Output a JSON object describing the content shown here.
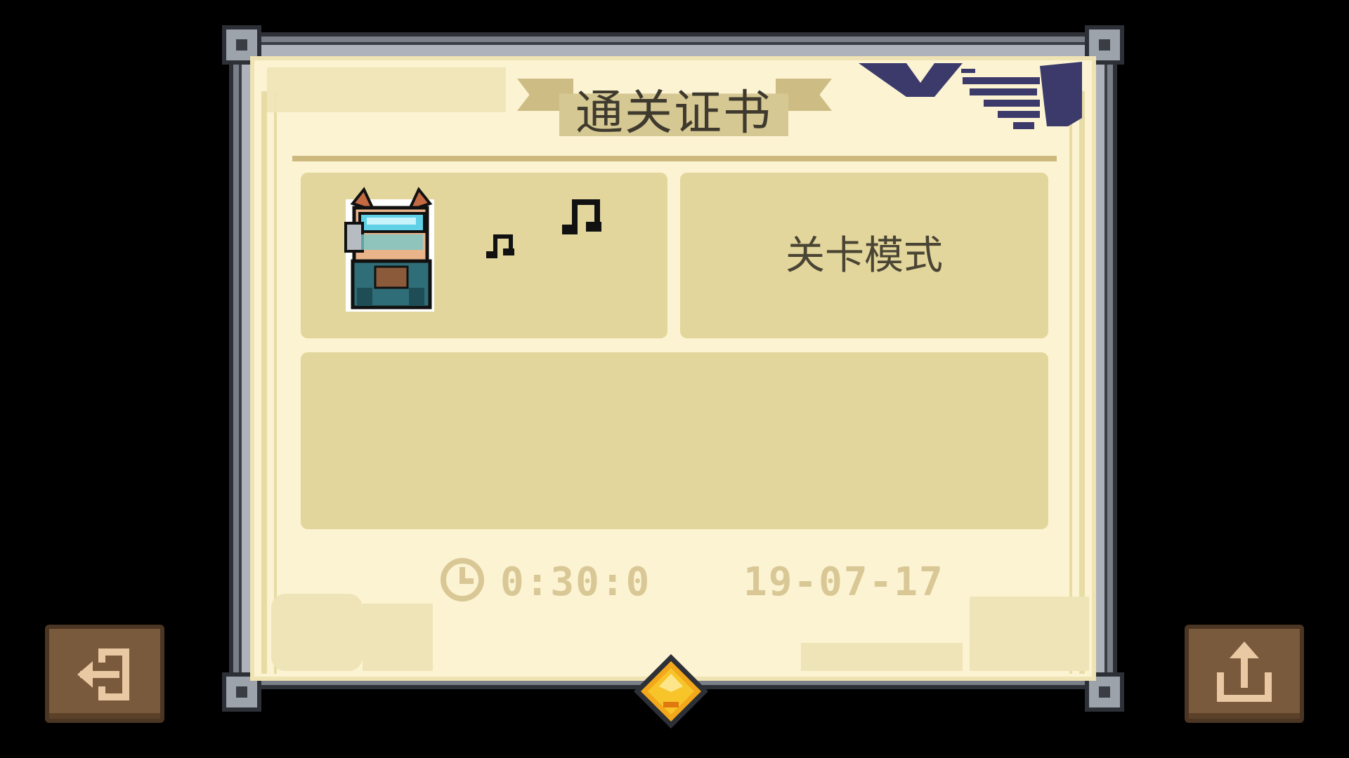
{
  "certificate": {
    "title": "通关证书",
    "mode_label": "关卡模式",
    "clear_time": "0:30:0",
    "date": "19-07-17"
  },
  "character": {
    "name_icon": "knight-character-icon",
    "effect": "music-notes-icon"
  },
  "buttons": {
    "exit_icon": "exit-door-icon",
    "share_icon": "share-upload-icon"
  },
  "colors": {
    "paper": "#fbf3d2",
    "panel": "#e2d69c",
    "button": "#7a5a3c",
    "accent_navy": "#3b3a6b",
    "gem": "#f2a81a"
  }
}
